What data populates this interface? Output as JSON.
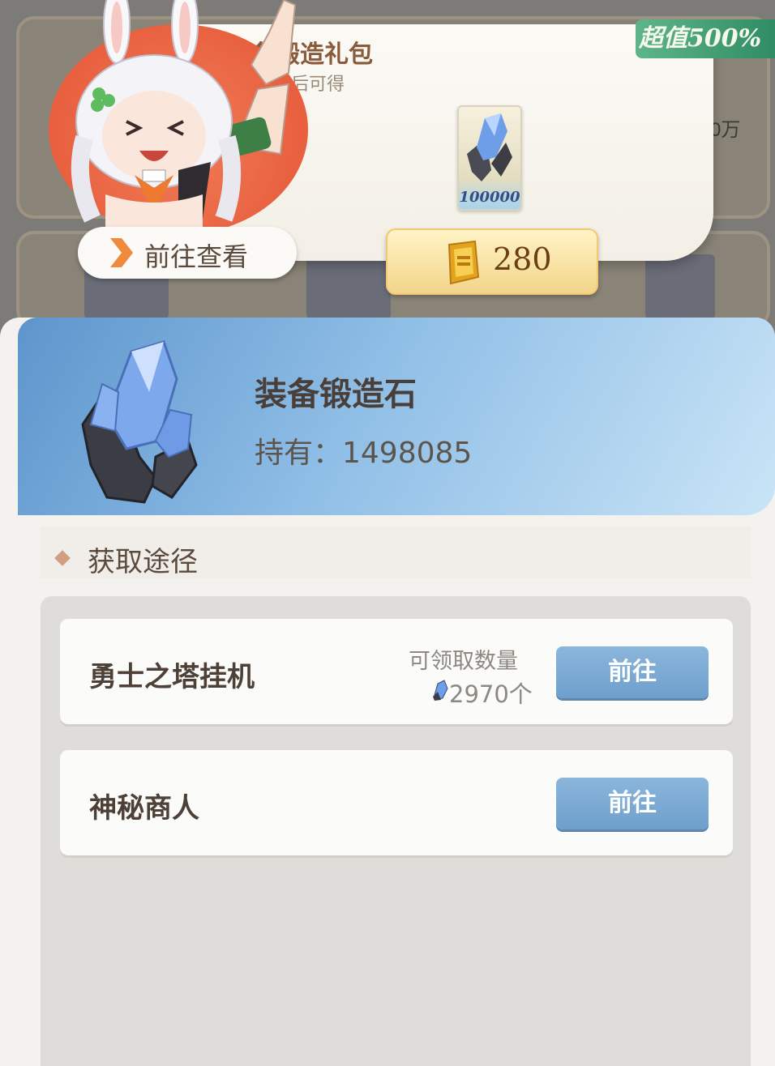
{
  "background": {
    "partial_text": "0万"
  },
  "promo": {
    "title": "装备锻造礼包",
    "subtitle": "购买后可得",
    "reward_count": "100000",
    "badge": "超值500%",
    "price": "280",
    "view_button_label": "前往查看"
  },
  "item": {
    "name": "装备锻造石",
    "owned_text": "持有：1498085"
  },
  "sources": {
    "heading": "获取途径",
    "rows": [
      {
        "name": "勇士之塔挂机",
        "claim_title": "可领取数量",
        "claim_quantity": "2970个",
        "button_label": "前往"
      },
      {
        "name": "神秘商人",
        "button_label": "前往"
      }
    ]
  },
  "colors": {
    "header_blue": "#8fbee6",
    "goto_button": "#7aa9d3",
    "badge_green": "#3e9e72",
    "price_gold": "#f3d58a"
  }
}
